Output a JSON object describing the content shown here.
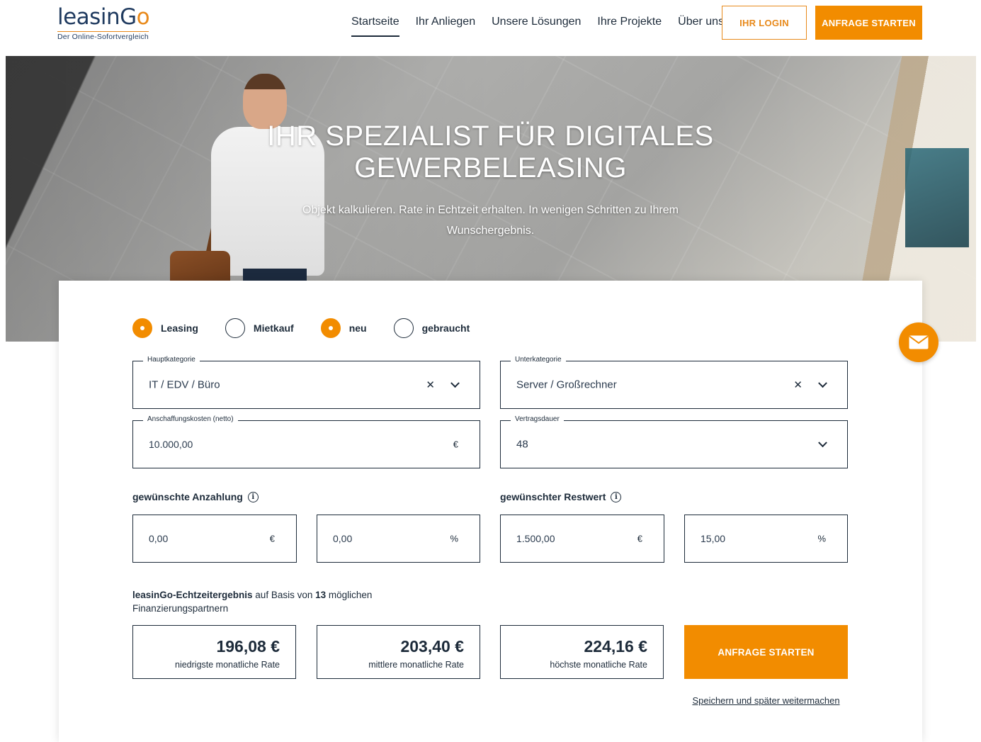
{
  "logo": {
    "main_prefix": "leasin",
    "main_g": "G",
    "main_o": "o",
    "subtitle": "Der Online-Sofortvergleich"
  },
  "nav": [
    {
      "label": "Startseite",
      "active": true
    },
    {
      "label": "Ihr Anliegen"
    },
    {
      "label": "Unsere Lösungen"
    },
    {
      "label": "Ihre Projekte"
    },
    {
      "label": "Über uns"
    }
  ],
  "header": {
    "login_label": "IHR LOGIN",
    "cta_label": "ANFRAGE STARTEN"
  },
  "hero": {
    "title_line1": "IHR SPEZIALIST FÜR DIGITALES",
    "title_line2": "GEWERBELEASING",
    "subtitle": "Objekt kalkulieren. Rate in Echtzeit erhalten. In wenigen Schritten zu Ihrem Wunschergebnis."
  },
  "form": {
    "radios": [
      {
        "label": "Leasing",
        "selected": true
      },
      {
        "label": "Mietkauf",
        "selected": false
      },
      {
        "label": "neu",
        "selected": true
      },
      {
        "label": "gebraucht",
        "selected": false
      }
    ],
    "hauptkategorie": {
      "legend": "Hauptkategorie",
      "value": "IT / EDV / Büro"
    },
    "unterkategorie": {
      "legend": "Unterkategorie",
      "value": "Server / Großrechner"
    },
    "anschaffungskosten": {
      "legend": "Anschaffungskosten (netto)",
      "value": "10.000,00",
      "unit": "€"
    },
    "vertragsdauer": {
      "legend": "Vertragsdauer",
      "value": "48"
    },
    "anzahlung": {
      "label": "gewünschte Anzahlung",
      "amount": "0,00",
      "amount_unit": "€",
      "percent": "0,00",
      "percent_unit": "%"
    },
    "restwert": {
      "label": "gewünschter Restwert",
      "amount": "1.500,00",
      "amount_unit": "€",
      "percent": "15,00",
      "percent_unit": "%"
    },
    "info_glyph": "i"
  },
  "result": {
    "intro_bold": "leasinGo-Echtzeitergebnis",
    "intro_mid": " auf Basis von ",
    "partner_count": "13",
    "intro_end": " möglichen Finanzierungspartnern",
    "boxes": [
      {
        "value": "196,08 €",
        "label": "niedrigste monatliche Rate"
      },
      {
        "value": "203,40 €",
        "label": "mittlere monatliche Rate"
      },
      {
        "value": "224,16 €",
        "label": "höchste monatliche Rate"
      }
    ],
    "cta_label": "ANFRAGE STARTEN",
    "save_link": "Speichern und später weitermachen"
  },
  "icons": {
    "clear": "clear-icon",
    "dropdown": "chevron-down-icon",
    "info": "info-icon",
    "mail": "mail-icon"
  },
  "colors": {
    "accent": "#f28c00",
    "navy": "#1d2b3a",
    "logo_blue": "#1f3a5f"
  }
}
